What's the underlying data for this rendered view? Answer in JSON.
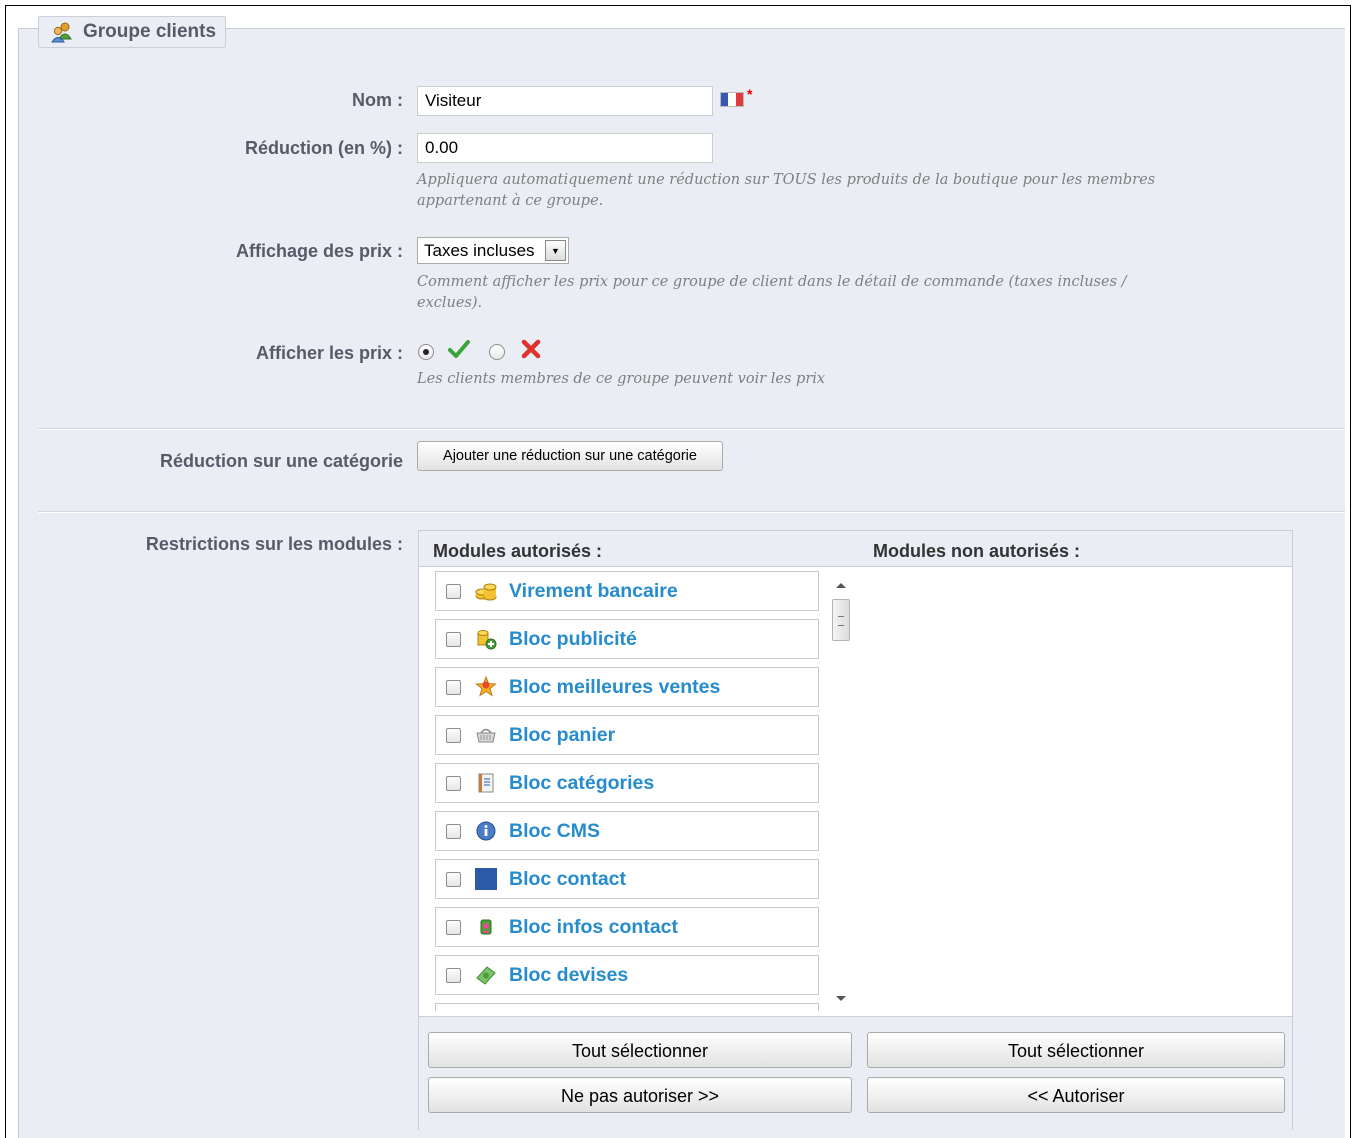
{
  "legend": {
    "title": "Groupe clients",
    "icon": "group-users-icon"
  },
  "form": {
    "name": {
      "label": "Nom :",
      "value": "Visiteur",
      "flag_icon": "french-flag-icon",
      "required_mark": "*"
    },
    "reduction": {
      "label": "Réduction (en %) :",
      "value": "0.00",
      "hint": "Appliquera automatiquement une réduction sur TOUS les produits de la boutique pour les membres appartenant à ce groupe."
    },
    "price_display": {
      "label": "Affichage des prix :",
      "selected": "Taxes incluses",
      "hint": "Comment afficher les prix pour ce groupe de client dans le détail de commande (taxes incluses / exclues)."
    },
    "show_prices": {
      "label": "Afficher les prix :",
      "selected": "yes",
      "yes_icon": "green-check-icon",
      "no_icon": "red-cross-icon",
      "hint": "Les clients membres de ce groupe peuvent voir les prix"
    },
    "category_reduction": {
      "label": "Réduction sur une catégorie",
      "button": "Ajouter une réduction sur une catégorie"
    },
    "module_restrictions": {
      "label": "Restrictions sur les modules :",
      "authorized_title": "Modules autorisés :",
      "unauthorized_title": "Modules non autorisés :",
      "authorized_modules": [
        {
          "name": "Virement bancaire",
          "icon": "coins-icon"
        },
        {
          "name": "Bloc publicité",
          "icon": "coins-add-icon"
        },
        {
          "name": "Bloc meilleures ventes",
          "icon": "award-star-icon"
        },
        {
          "name": "Bloc panier",
          "icon": "basket-icon"
        },
        {
          "name": "Bloc catégories",
          "icon": "notebook-icon"
        },
        {
          "name": "Bloc CMS",
          "icon": "info-icon"
        },
        {
          "name": "Bloc contact",
          "icon": "blue-square-icon"
        },
        {
          "name": "Bloc infos contact",
          "icon": "contact-book-icon"
        },
        {
          "name": "Bloc devises",
          "icon": "money-icon"
        }
      ],
      "unauthorized_modules": [],
      "select_all_left": "Tout sélectionner",
      "select_all_right": "Tout sélectionner",
      "disallow_button": "Ne pas autoriser >>",
      "allow_button": "<< Autoriser"
    }
  }
}
